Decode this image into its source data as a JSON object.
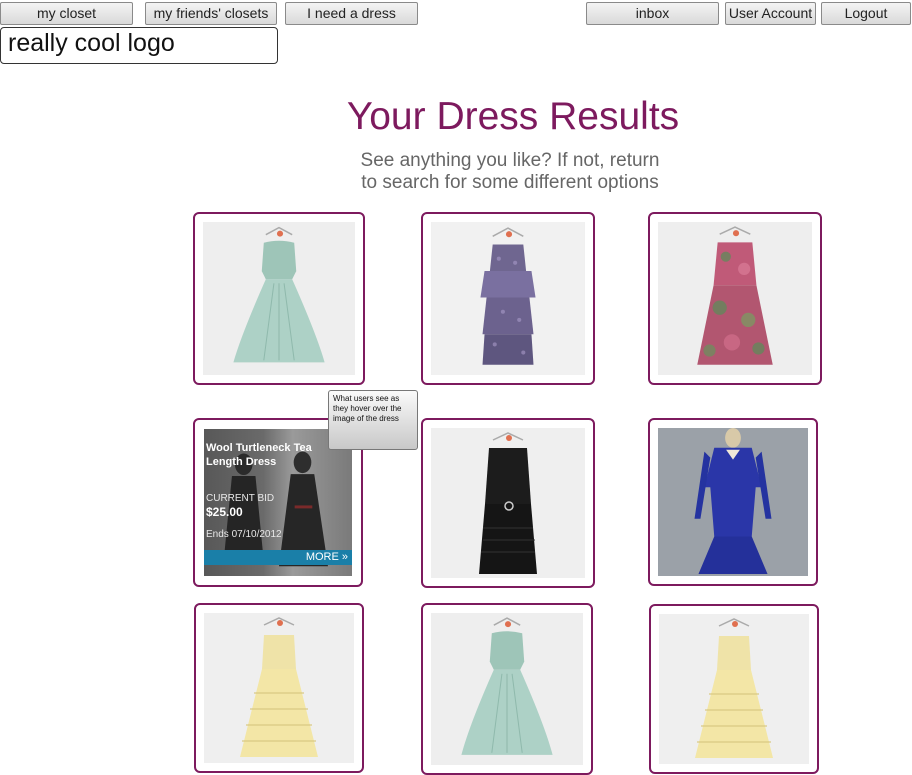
{
  "nav": {
    "my_closet": "my closet",
    "friends_closets": "my friends' closets",
    "need_dress": "I need a dress",
    "inbox": "inbox",
    "user_account": "User Account",
    "logout": "Logout"
  },
  "logo": "really cool logo",
  "page": {
    "title": "Your Dress Results",
    "subtitle_line1": "See anything you like? If not, return",
    "subtitle_line2": "to search for some different options"
  },
  "results": [
    {
      "dress": "mint tulle strapless gown"
    },
    {
      "dress": "purple printed tiered dress"
    },
    {
      "dress": "pink floral sleeveless dress"
    },
    {
      "dress": "wool turtleneck tea length dress (hovered)"
    },
    {
      "dress": "black drop-waist dress"
    },
    {
      "dress": "royal blue long-sleeve dress"
    },
    {
      "dress": "yellow tiered tulle gown"
    },
    {
      "dress": "mint tulle strapless gown"
    },
    {
      "dress": "yellow tiered tulle gown"
    }
  ],
  "hover_card": {
    "title": "Wool Turtleneck Tea Length Dress",
    "bid_label": "CURRENT BID",
    "bid_value": "$25.00",
    "ends": "Ends 07/10/2012",
    "more": "MORE »"
  },
  "tooltip": "What users see as they hover over the image of the dress",
  "colors": {
    "accent": "#7d1a5e",
    "more_bar": "#1a7fa8",
    "subtitle": "#666666"
  }
}
